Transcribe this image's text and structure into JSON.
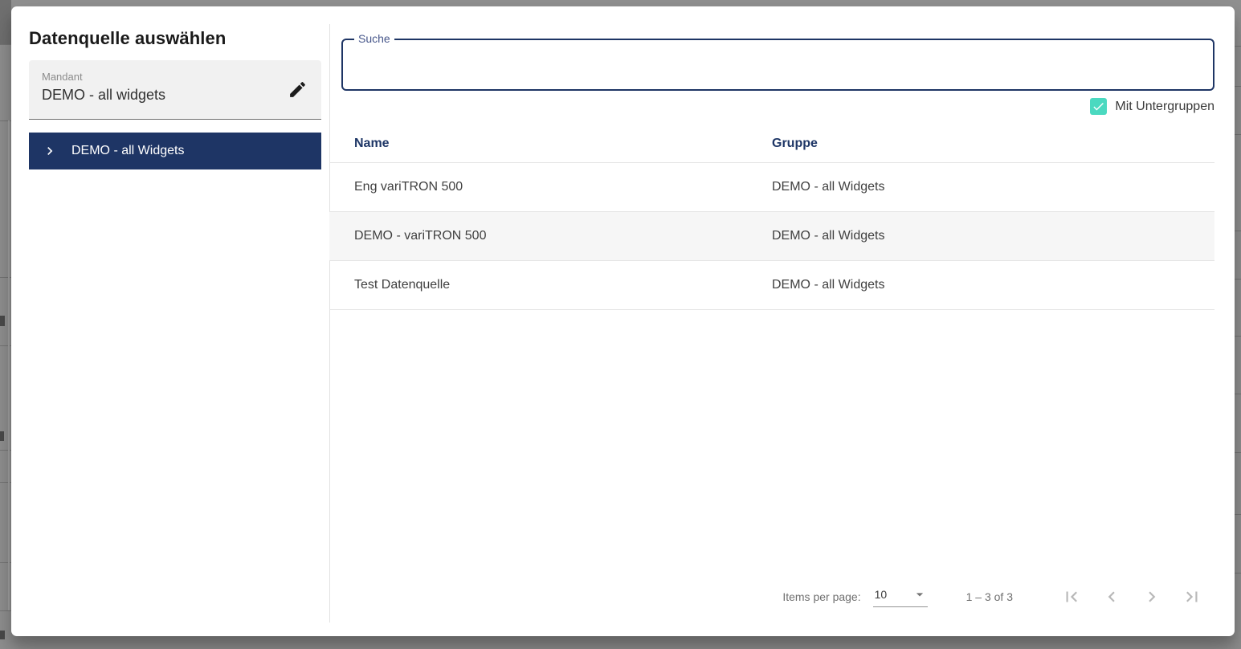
{
  "colors": {
    "primary_navy": "#1e3565",
    "accent_teal": "#4bd9c0",
    "row_highlight": "#f6f6f6"
  },
  "dialog": {
    "title": "Datenquelle auswählen",
    "left_panel": {
      "mandant_label": "Mandant",
      "mandant_value": "DEMO - all widgets",
      "tree_item_label": "DEMO - all Widgets"
    },
    "right_panel": {
      "search_label": "Suche",
      "search_value": "",
      "subgroups_label": "Mit Untergruppen",
      "subgroups_checked": true,
      "table": {
        "columns": [
          "Name",
          "Gruppe"
        ],
        "rows": [
          {
            "name": "Eng variTRON 500",
            "gruppe": "DEMO - all Widgets"
          },
          {
            "name": "DEMO - variTRON 500",
            "gruppe": "DEMO - all Widgets"
          },
          {
            "name": "Test Datenquelle",
            "gruppe": "DEMO - all Widgets"
          }
        ]
      },
      "paginator": {
        "items_per_page_label": "Items per page:",
        "items_per_page_value": "10",
        "range_label": "1 – 3 of 3"
      }
    }
  }
}
